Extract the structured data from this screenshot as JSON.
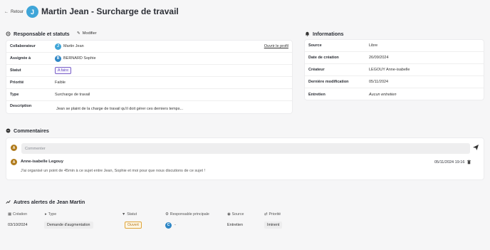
{
  "header": {
    "back_label": "Retour",
    "avatar_letter": "J",
    "title": "Martin Jean - Surcharge de travail"
  },
  "responsable": {
    "title": "Responsable et statuts",
    "edit_label": "Modifier",
    "rows": {
      "collaborateur": {
        "label": "Collaborateur",
        "avatar": "J",
        "value": "Martin Jean",
        "link": "Ouvrir le profil"
      },
      "assignee": {
        "label": "Assignée à",
        "avatar": "B",
        "value": "BERNARD Sophie"
      },
      "statut": {
        "label": "Statut",
        "value": "A faire"
      },
      "priorite": {
        "label": "Priorité",
        "value": "Faible"
      },
      "type": {
        "label": "Type",
        "value": "Surcharge de travail"
      },
      "description": {
        "label": "Description",
        "value": "Jean se plaint de la charge de travail qu'il doit gérer ces derniers temps..."
      }
    }
  },
  "informations": {
    "title": "Informations",
    "rows": [
      {
        "label": "Source",
        "value": "Libre"
      },
      {
        "label": "Date de création",
        "value": "26/09/2024"
      },
      {
        "label": "Créateur",
        "value": "LEGOUY Anne-isabelle"
      },
      {
        "label": "Dernière modification",
        "value": "05/11/2024"
      },
      {
        "label": "Entretien",
        "value": "Aucun entretien"
      }
    ]
  },
  "comments": {
    "title": "Commentaires",
    "input_avatar": "A",
    "placeholder": "Commenter",
    "items": [
      {
        "avatar": "A",
        "author": "Anne-isabelle Legouy",
        "date": "05/11/2024 19:16",
        "text": "J'ai organisé un point de 45min à ce sujet entre Jean, Sophie et moi pour que nous discutions de ce sujet !"
      }
    ]
  },
  "alerts": {
    "title": "Autres alertes de Jean Martin",
    "columns": [
      "Création",
      "Type",
      "Statut",
      "Responsable principale",
      "Source",
      "Priorité"
    ],
    "rows": [
      {
        "creation": "03/10/2024",
        "type": "Demande d'augmentation",
        "statut": "Ouvert",
        "responsable_avatar": "C",
        "responsable": "-",
        "source": "Entretien",
        "priorite": "Iminent"
      }
    ]
  },
  "colors": {
    "accent_blue": "#3fa5d8",
    "avatar_brown": "#b07b1c",
    "avatar_blue": "#2f87c6",
    "status_purple": "#7b61c9",
    "status_orange": "#e0a53a"
  }
}
